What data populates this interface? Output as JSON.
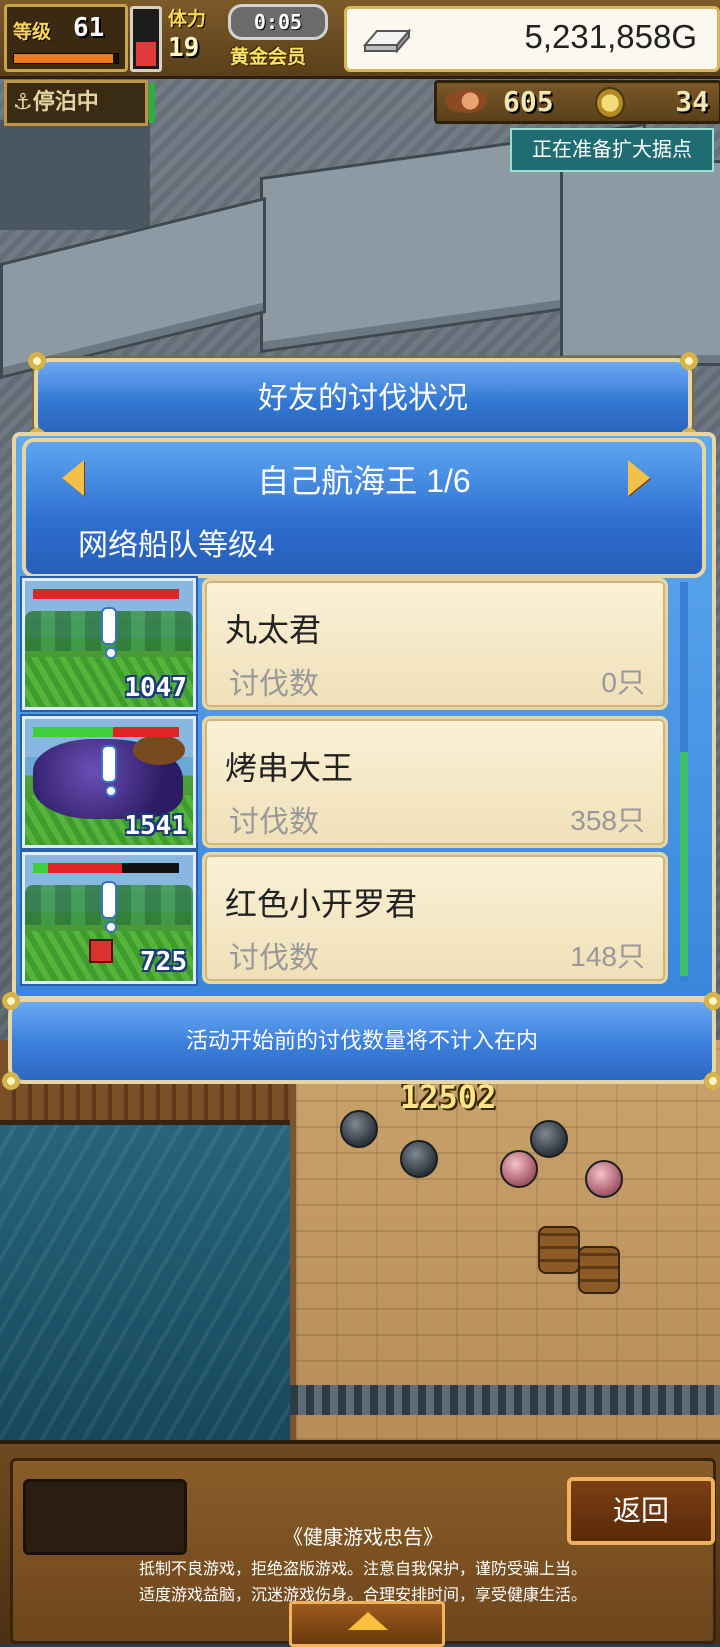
{
  "hud": {
    "level_label": "等级",
    "level_value": "61",
    "level_progress": 0.95,
    "vial_level": 0.45,
    "stamina_label": "体力",
    "stamina_value": "19",
    "timer": "0:05",
    "membership": "黄金会员",
    "gold": "5,231,858G",
    "docked_label": "停泊中",
    "food_count": "605",
    "medal_count": "34",
    "expand_status": "正在准备扩大据点"
  },
  "dialog": {
    "title": "好友的讨伐状况",
    "nav_title": "自己航海王 1/6",
    "fleet_level": "网络船队等级4",
    "rows": [
      {
        "name": "丸太君",
        "label": "讨伐数",
        "count": "0只",
        "power": "1047",
        "hp_ratio": 1.0,
        "hp_color": "#e02424"
      },
      {
        "name": "烤串大王",
        "label": "讨伐数",
        "count": "358只",
        "power": "1541",
        "hp_ratio": 0.55,
        "hp_color": "#3dd03a"
      },
      {
        "name": "红色小开罗君",
        "label": "讨伐数",
        "count": "148只",
        "power": "725",
        "hp_ratio": 0.1,
        "hp_color": "#3dd03a"
      }
    ],
    "notice": "活动开始前的讨伐数量将不计入在内"
  },
  "scene": {
    "damage_number": "12502"
  },
  "bottom": {
    "back_label": "返回",
    "advisory_title": "《健康游戏忠告》",
    "advisory_line1": "抵制不良游戏，拒绝盗版游戏。注意自我保护，谨防受骗上当。",
    "advisory_line2": "适度游戏益脑，沉迷游戏伤身。合理安排时间，享受健康生活。"
  }
}
